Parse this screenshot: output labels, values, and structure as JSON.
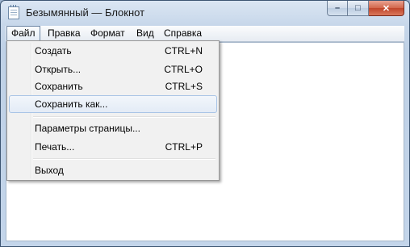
{
  "window": {
    "title": "Безымянный — Блокнот",
    "icon": "notepad-icon"
  },
  "caption_buttons": {
    "minimize_glyph": "–",
    "maximize_glyph": "□",
    "close_glyph": "✕"
  },
  "menubar": {
    "items": [
      {
        "label": "Файл",
        "active": true
      },
      {
        "label": "Правка"
      },
      {
        "label": "Формат"
      },
      {
        "label": "Вид"
      },
      {
        "label": "Справка"
      }
    ]
  },
  "file_menu": {
    "items": [
      {
        "label": "Создать",
        "shortcut": "CTRL+N"
      },
      {
        "label": "Открыть...",
        "shortcut": "CTRL+O"
      },
      {
        "label": "Сохранить",
        "shortcut": "CTRL+S"
      },
      {
        "label": "Сохранить как...",
        "shortcut": "",
        "highlighted": true
      },
      {
        "label": "Параметры страницы...",
        "shortcut": ""
      },
      {
        "label": "Печать...",
        "shortcut": "CTRL+P"
      },
      {
        "label": "Выход",
        "shortcut": ""
      }
    ]
  },
  "colors": {
    "title_bar": "#c7d7ea",
    "menu_background": "#f1f1f1",
    "highlight_border": "#a8c4e6",
    "close_button": "#c0452a"
  }
}
